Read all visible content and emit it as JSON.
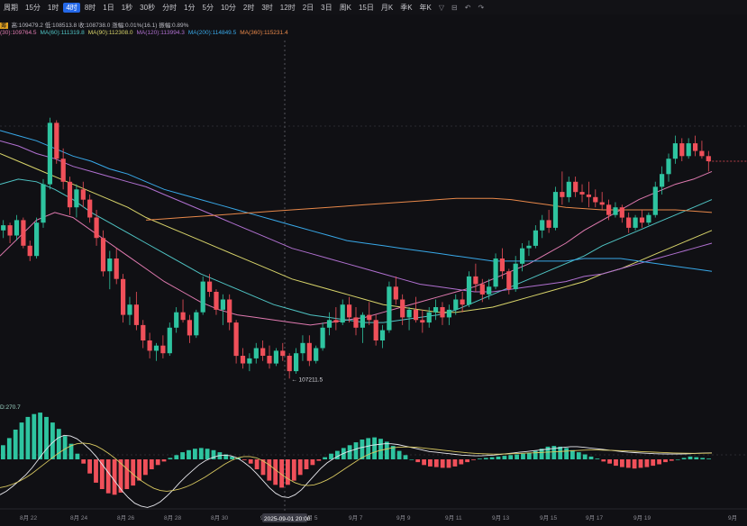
{
  "toolbar": {
    "items": [
      "周期",
      "15分",
      "1时",
      "4时",
      "8时",
      "1日",
      "1秒",
      "30秒",
      "分时",
      "1分",
      "5分",
      "10分",
      "2时",
      "3时",
      "12时",
      "2日",
      "3日",
      "周K",
      "15日",
      "月K",
      "季K",
      "年K"
    ],
    "active_index": 3
  },
  "info": {
    "ohlc_label": "高:109479.2  低:108513.8  收:108738.0  涨幅:0.01%(16.1)  振幅:0.89%",
    "badge": "筹",
    "ma": [
      {
        "label": "(30):109764.5",
        "color": "#e07ab0"
      },
      {
        "label": "MA(60):111319.8",
        "color": "#4fc4c4"
      },
      {
        "label": "MA(90):112308.0",
        "color": "#d8d46a"
      },
      {
        "label": "MA(120):113994.3",
        "color": "#b070d0"
      },
      {
        "label": "MA(200):114849.5",
        "color": "#38a8e8"
      },
      {
        "label": "MA(360):115231.4",
        "color": "#e8884a"
      }
    ]
  },
  "macd_label": "D:270.7",
  "chart_data": {
    "type": "candlestick",
    "x_ticks": [
      "8月 22",
      "8月 24",
      "8月 26",
      "8月 28",
      "8月 30",
      "9月 3",
      "9月 5",
      "9月 7",
      "9月 9",
      "9月 11",
      "9月 13",
      "9月 15",
      "9月 17",
      "9月 19",
      "9月"
    ],
    "x_start": "8月 21",
    "candle_hours": 4,
    "low_marker": {
      "label": "← 107211.5",
      "value": 107211.5
    },
    "crosshair_label": "2025-09-01 20:00",
    "colors": {
      "up": "#2ec4a0",
      "down": "#f0505a"
    },
    "candles": [
      [
        113000,
        113400,
        112700,
        113200
      ],
      [
        113200,
        113300,
        112500,
        112800
      ],
      [
        112800,
        113600,
        112600,
        113400
      ],
      [
        113400,
        113500,
        112300,
        112400
      ],
      [
        112400,
        112600,
        111800,
        112000
      ],
      [
        112000,
        113500,
        111900,
        113300
      ],
      [
        113300,
        115000,
        113100,
        114800
      ],
      [
        114800,
        117400,
        114600,
        117200
      ],
      [
        117200,
        117300,
        115600,
        115800
      ],
      [
        115800,
        116200,
        114600,
        114900
      ],
      [
        114900,
        115100,
        113600,
        113900
      ],
      [
        113900,
        114800,
        113500,
        114600
      ],
      [
        114600,
        114900,
        113900,
        114200
      ],
      [
        114200,
        114400,
        113300,
        113500
      ],
      [
        113500,
        113800,
        112400,
        112700
      ],
      [
        112700,
        113000,
        111200,
        111400
      ],
      [
        111400,
        112200,
        110700,
        111900
      ],
      [
        111900,
        112300,
        110900,
        111100
      ],
      [
        111100,
        111300,
        109400,
        109700
      ],
      [
        109700,
        110400,
        109300,
        110100
      ],
      [
        110100,
        110600,
        109100,
        109300
      ],
      [
        109300,
        109500,
        108400,
        108700
      ],
      [
        108700,
        109000,
        108000,
        108300
      ],
      [
        108300,
        108600,
        107900,
        108500
      ],
      [
        108500,
        108900,
        108000,
        108200
      ],
      [
        108200,
        109400,
        108100,
        109200
      ],
      [
        109200,
        110000,
        109000,
        109800
      ],
      [
        109800,
        110300,
        109400,
        109500
      ],
      [
        109500,
        109700,
        108600,
        108900
      ],
      [
        108900,
        109900,
        108800,
        109800
      ],
      [
        109800,
        111200,
        109700,
        111000
      ],
      [
        111000,
        111300,
        110400,
        110600
      ],
      [
        110600,
        110700,
        109700,
        109900
      ],
      [
        109900,
        110500,
        109300,
        110300
      ],
      [
        110300,
        110500,
        109100,
        109400
      ],
      [
        109400,
        109500,
        107800,
        108100
      ],
      [
        108100,
        108400,
        107600,
        107800
      ],
      [
        107800,
        108200,
        107500,
        108000
      ],
      [
        108000,
        108600,
        107800,
        108400
      ],
      [
        108400,
        108700,
        107900,
        108100
      ],
      [
        108100,
        108500,
        107600,
        107800
      ],
      [
        107800,
        108400,
        107700,
        108300
      ],
      [
        108300,
        108600,
        107900,
        108100
      ],
      [
        108100,
        108200,
        107211.5,
        107500
      ],
      [
        107500,
        108400,
        107400,
        108200
      ],
      [
        108200,
        108900,
        107900,
        108600
      ],
      [
        108600,
        108900,
        107700,
        107900
      ],
      [
        107900,
        108500,
        107800,
        108400
      ],
      [
        108400,
        109400,
        108300,
        109200
      ],
      [
        109200,
        109800,
        108900,
        109500
      ],
      [
        109500,
        110000,
        109100,
        109400
      ],
      [
        109400,
        110300,
        109300,
        110100
      ],
      [
        110100,
        110400,
        109400,
        109600
      ],
      [
        109600,
        110000,
        108900,
        109200
      ],
      [
        109200,
        109800,
        108600,
        109700
      ],
      [
        109700,
        110200,
        109300,
        109500
      ],
      [
        109500,
        109700,
        108500,
        108700
      ],
      [
        108700,
        109300,
        108400,
        109100
      ],
      [
        109100,
        111000,
        109000,
        110800
      ],
      [
        110800,
        111200,
        110100,
        110300
      ],
      [
        110300,
        110500,
        109300,
        109600
      ],
      [
        109600,
        110000,
        109100,
        109900
      ],
      [
        109900,
        110400,
        109400,
        109500
      ],
      [
        109500,
        109900,
        109000,
        109400
      ],
      [
        109400,
        110000,
        109200,
        109800
      ],
      [
        109800,
        110300,
        109500,
        110000
      ],
      [
        110000,
        110200,
        109300,
        109600
      ],
      [
        109600,
        110100,
        109300,
        109900
      ],
      [
        109900,
        110500,
        109700,
        110300
      ],
      [
        110300,
        110600,
        109800,
        110100
      ],
      [
        110100,
        111400,
        110000,
        111200
      ],
      [
        111200,
        111700,
        110600,
        110900
      ],
      [
        110900,
        111100,
        110200,
        110500
      ],
      [
        110500,
        111100,
        110300,
        110800
      ],
      [
        110800,
        112100,
        110700,
        111900
      ],
      [
        111900,
        112300,
        111100,
        111400
      ],
      [
        111400,
        111500,
        110500,
        110700
      ],
      [
        110700,
        112000,
        110600,
        111700
      ],
      [
        111700,
        112500,
        111400,
        112300
      ],
      [
        112300,
        112600,
        112000,
        112400
      ],
      [
        112400,
        113200,
        112300,
        113000
      ],
      [
        113000,
        113600,
        112700,
        113400
      ],
      [
        113400,
        113800,
        112900,
        113100
      ],
      [
        113100,
        114700,
        113000,
        114500
      ],
      [
        114500,
        115300,
        114000,
        114300
      ],
      [
        114300,
        115100,
        114100,
        114900
      ],
      [
        114900,
        115100,
        114300,
        114500
      ],
      [
        114500,
        114800,
        114100,
        114400
      ],
      [
        114400,
        114900,
        113900,
        114300
      ],
      [
        114300,
        114600,
        113900,
        114100
      ],
      [
        114100,
        114500,
        113800,
        114000
      ],
      [
        114000,
        114200,
        113400,
        113600
      ],
      [
        113600,
        114100,
        113500,
        113900
      ],
      [
        113900,
        114000,
        113300,
        113500
      ],
      [
        113500,
        113700,
        112900,
        113100
      ],
      [
        113100,
        113600,
        113000,
        113500
      ],
      [
        113500,
        113800,
        113100,
        113300
      ],
      [
        113300,
        113700,
        113200,
        113600
      ],
      [
        113600,
        114900,
        113500,
        114700
      ],
      [
        114700,
        115500,
        114400,
        115200
      ],
      [
        115200,
        116000,
        114900,
        115800
      ],
      [
        115800,
        116700,
        115600,
        116400
      ],
      [
        116400,
        116600,
        115700,
        115900
      ],
      [
        115900,
        116600,
        115800,
        116400
      ],
      [
        116400,
        116700,
        115900,
        116100
      ],
      [
        116100,
        116500,
        115800,
        115900
      ],
      [
        115900,
        116100,
        115300,
        115700
      ]
    ],
    "ma_values": {
      "ma30": [
        112000,
        112700,
        113400,
        113700,
        113500,
        113000,
        112500,
        112000,
        111500,
        111000,
        110600,
        110200,
        109900,
        109700,
        109600,
        109500,
        109400,
        109300,
        109400,
        109500,
        109600,
        109800,
        110000,
        110200,
        110400,
        110600,
        110800,
        111100,
        111400,
        111700,
        112100,
        112500,
        113000,
        113400,
        113800,
        114200,
        114500,
        114800,
        115000,
        115300
      ],
      "ma60": [
        114800,
        115000,
        114900,
        114600,
        114200,
        113700,
        113300,
        112900,
        112500,
        112100,
        111700,
        111300,
        111000,
        110700,
        110400,
        110100,
        109900,
        109700,
        109600,
        109500,
        109400,
        109400,
        109500,
        109600,
        109700,
        109900,
        110200,
        110500,
        110800,
        111100,
        111400,
        111700,
        112000,
        112400,
        112700,
        113000,
        113300,
        113600,
        113900,
        114200
      ],
      "ma90": [
        116000,
        115700,
        115400,
        115100,
        114800,
        114500,
        114200,
        113900,
        113500,
        113200,
        112900,
        112600,
        112300,
        112000,
        111700,
        111400,
        111100,
        110900,
        110700,
        110500,
        110300,
        110100,
        110000,
        109900,
        109800,
        109800,
        109900,
        110000,
        110200,
        110400,
        110600,
        110800,
        111000,
        111300,
        111500,
        111800,
        112100,
        112400,
        112700,
        113000
      ],
      "ma120": [
        116500,
        116300,
        116000,
        115800,
        115500,
        115300,
        115100,
        114900,
        114700,
        114400,
        114100,
        113800,
        113500,
        113200,
        112900,
        112600,
        112300,
        112100,
        111900,
        111700,
        111500,
        111300,
        111100,
        110900,
        110800,
        110700,
        110600,
        110600,
        110700,
        110800,
        110900,
        111000,
        111200,
        111300,
        111500,
        111700,
        111900,
        112100,
        112300,
        112500
      ],
      "ma200": [
        116900,
        116700,
        116500,
        116200,
        115900,
        115700,
        115400,
        115200,
        114900,
        114600,
        114400,
        114200,
        114000,
        113800,
        113600,
        113400,
        113200,
        113000,
        112800,
        112600,
        112500,
        112400,
        112300,
        112200,
        112100,
        112000,
        111900,
        111800,
        111800,
        111800,
        111800,
        111800,
        111900,
        111900,
        111900,
        111800,
        111700,
        111600,
        111500,
        111400
      ],
      "ma360": [
        null,
        null,
        null,
        null,
        null,
        null,
        null,
        null,
        113400,
        113450,
        113500,
        113550,
        113600,
        113650,
        113700,
        113750,
        113800,
        113850,
        113900,
        113950,
        114000,
        114050,
        114100,
        114150,
        114200,
        114250,
        114250,
        114250,
        114200,
        114100,
        114000,
        113900,
        113850,
        113800,
        113800,
        113800,
        113800,
        113800,
        113750,
        113700
      ]
    },
    "macd": {
      "hist": [
        200,
        300,
        420,
        520,
        600,
        640,
        660,
        600,
        520,
        430,
        330,
        220,
        80,
        -60,
        -200,
        -330,
        -420,
        -480,
        -500,
        -470,
        -420,
        -370,
        -300,
        -220,
        -140,
        -80,
        -30,
        20,
        60,
        100,
        130,
        150,
        160,
        150,
        130,
        100,
        70,
        40,
        20,
        -10,
        -60,
        -140,
        -220,
        -300,
        -360,
        -400,
        -360,
        -300,
        -220,
        -140,
        -80,
        -20,
        30,
        80,
        120,
        160,
        200,
        240,
        280,
        300,
        310,
        290,
        250,
        190,
        120,
        60,
        0,
        -40,
        -80,
        -100,
        -110,
        -120,
        -120,
        -100,
        -70,
        -40,
        -10,
        10,
        20,
        30,
        40,
        50,
        60,
        70,
        80,
        90,
        120,
        150,
        180,
        190,
        180,
        160,
        130,
        100,
        70,
        40,
        10,
        -30,
        -60,
        -90,
        -110,
        -120,
        -130,
        -120,
        -110,
        -90,
        -70,
        -40,
        -20,
        0,
        20,
        40,
        30,
        20,
        10
      ],
      "dif": [
        -500,
        -450,
        -380,
        -300,
        -220,
        -120,
        0,
        120,
        220,
        300,
        340,
        330,
        290,
        220,
        140,
        40,
        -80,
        -200,
        -320,
        -440,
        -540,
        -620,
        -660,
        -680,
        -650,
        -600,
        -520,
        -430,
        -330,
        -240,
        -160,
        -80,
        -20,
        20,
        50,
        60,
        50,
        20,
        -40,
        -110,
        -200,
        -300,
        -400,
        -480,
        -530,
        -540,
        -500,
        -430,
        -330,
        -230,
        -130,
        -50,
        10,
        60,
        100,
        130,
        160,
        180,
        200,
        210,
        220,
        220,
        210,
        190,
        170,
        150,
        130,
        110,
        100,
        90,
        80,
        70,
        60,
        55,
        50,
        50,
        55,
        60,
        70,
        80,
        90,
        100,
        110,
        120,
        130,
        140,
        150,
        160,
        170,
        180,
        180,
        170,
        160,
        150,
        140,
        130,
        120,
        110,
        100,
        95,
        90,
        85,
        80,
        78,
        76,
        75,
        75,
        78,
        82,
        86,
        90,
        92
      ],
      "dea": [
        -400,
        -380,
        -350,
        -310,
        -260,
        -200,
        -130,
        -60,
        10,
        80,
        140,
        190,
        220,
        230,
        220,
        190,
        140,
        80,
        10,
        -70,
        -150,
        -230,
        -300,
        -360,
        -410,
        -440,
        -450,
        -440,
        -420,
        -390,
        -350,
        -300,
        -250,
        -190,
        -130,
        -70,
        -20,
        20,
        40,
        40,
        20,
        -20,
        -80,
        -150,
        -220,
        -280,
        -330,
        -360,
        -370,
        -360,
        -330,
        -290,
        -240,
        -180,
        -120,
        -60,
        0,
        50,
        90,
        120,
        140,
        160,
        170,
        175,
        175,
        170,
        160,
        150,
        140,
        130,
        120,
        110,
        100,
        92,
        85,
        80,
        76,
        74,
        74,
        76,
        80,
        84,
        88,
        92,
        96,
        100,
        105,
        110,
        115,
        120,
        125,
        130,
        132,
        132,
        130,
        128,
        125,
        122,
        118,
        114,
        110,
        106,
        102,
        98,
        94,
        90,
        88,
        86,
        85,
        85,
        86,
        88
      ]
    }
  }
}
